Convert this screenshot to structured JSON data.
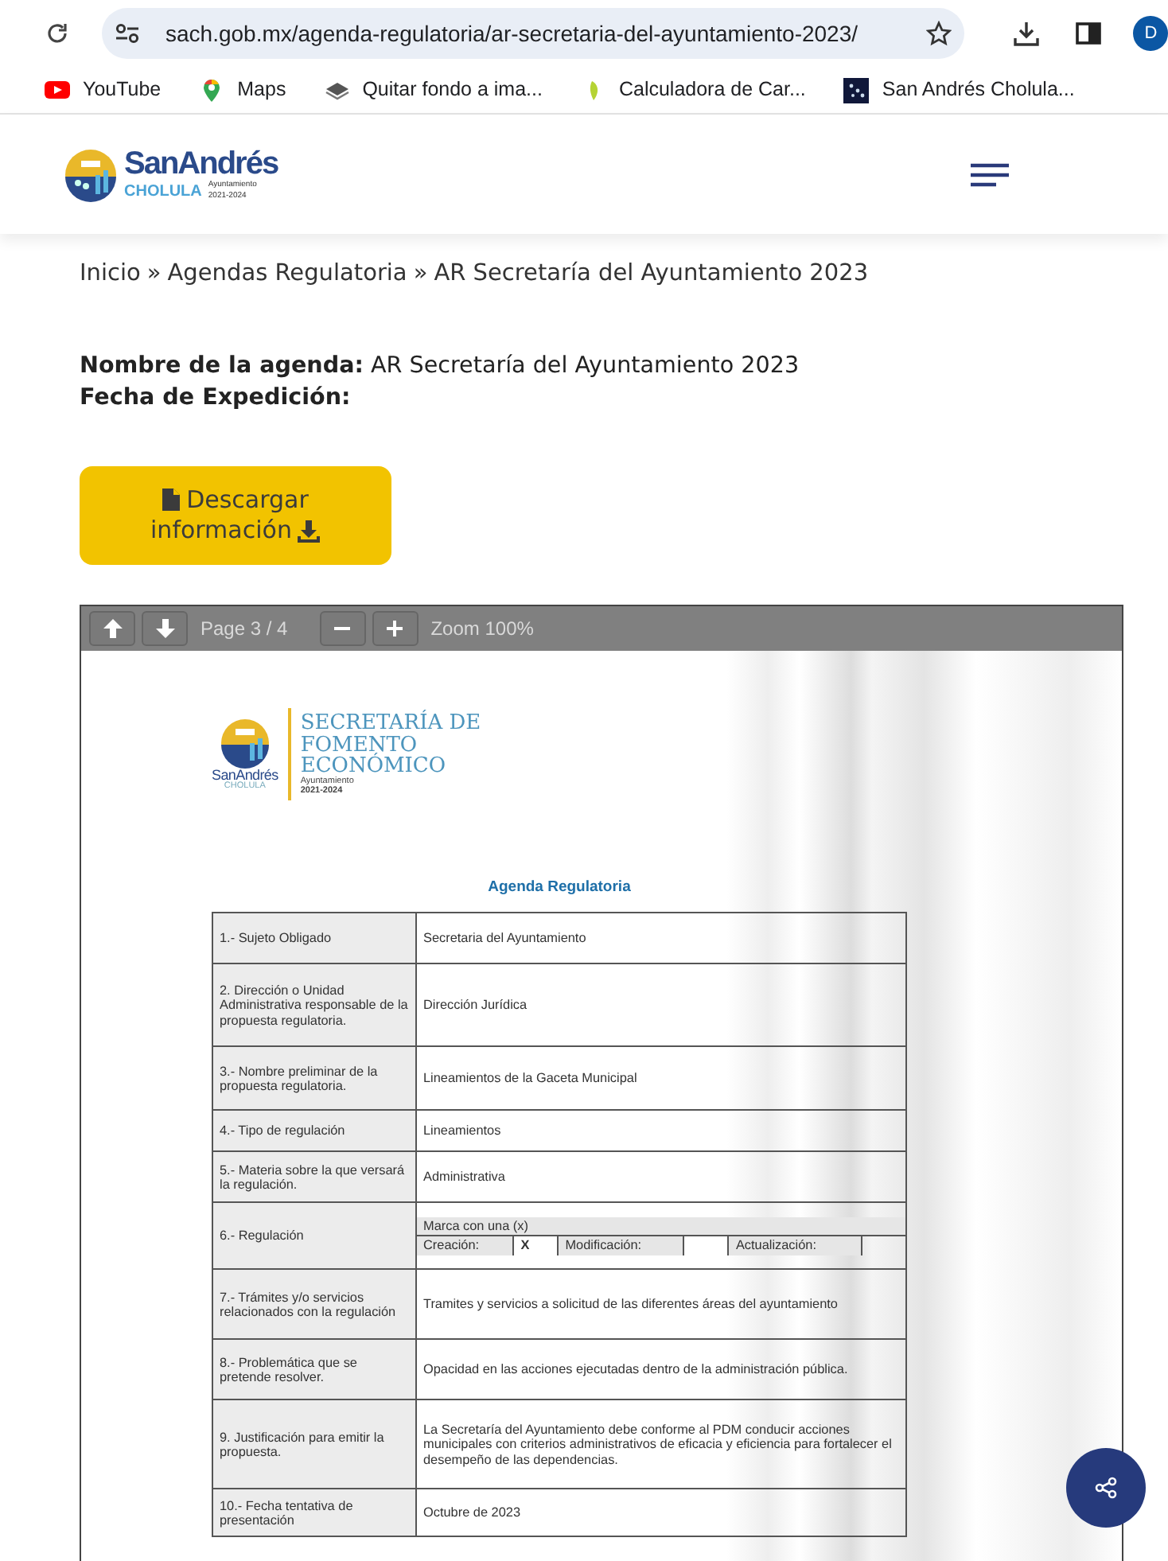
{
  "browser": {
    "url": "sach.gob.mx/agenda-regulatoria/ar-secretaria-del-ayuntamiento-2023/",
    "profile_initial": "D",
    "bookmarks": [
      {
        "label": "YouTube",
        "kind": "youtube"
      },
      {
        "label": "Maps",
        "kind": "maps"
      },
      {
        "label": "Quitar fondo a ima...",
        "kind": "layers"
      },
      {
        "label": "Calculadora de Car...",
        "kind": "leaf"
      },
      {
        "label": "San Andrés Cholula...",
        "kind": "site"
      }
    ]
  },
  "site_logo": {
    "name_a": "San",
    "name_b": "Andrés",
    "place": "CHOLULA",
    "tag_1": "Ayuntamiento",
    "tag_2": "2021-2024"
  },
  "breadcrumb": {
    "separator": "»",
    "items": [
      "Inicio",
      "Agendas Regulatoria",
      "AR Secretaría del Ayuntamiento 2023"
    ]
  },
  "fields": [
    {
      "label": "Nombre de la agenda:",
      "value": "AR Secretaría del Ayuntamiento 2023"
    },
    {
      "label": "Fecha de Expedición:"
    }
  ],
  "download_button": {
    "line_1": "Descargar",
    "line_2": "información"
  },
  "pdf_viewer": {
    "page": "Page 3 / 4",
    "zoom": "Zoom 100%",
    "document": {
      "logo_name_a": "San",
      "logo_name_b": "Andrés",
      "logo_place": "CHOLULA",
      "heading": [
        "SECRETARÍA DE",
        "FOMENTO",
        "ECONÓMICO"
      ],
      "tag_1": "Ayuntamiento",
      "tag_2": "2021-2024",
      "title": "Agenda Regulatoria",
      "rows": [
        {
          "kind": "text",
          "label": "1.- Sujeto Obligado",
          "value": "Secretaria del Ayuntamiento"
        },
        {
          "kind": "text",
          "label": "2.  Dirección o Unidad Administrativa responsable de la propuesta regulatoria.",
          "value": "Dirección Jurídica"
        },
        {
          "kind": "text",
          "label": "3.- Nombre preliminar de la propuesta regulatoria.",
          "value": "Lineamientos de la Gaceta Municipal"
        },
        {
          "kind": "text",
          "label": "4.- Tipo de regulación",
          "value": "Lineamientos"
        },
        {
          "kind": "text",
          "label": "5.- Materia sobre la que versará la regulación.",
          "value": "Administrativa"
        },
        {
          "kind": "options",
          "label": "6.- Regulación",
          "instruction": "Marca con una (x)",
          "options": [
            {
              "label": "Creación:",
              "mark": "X"
            },
            {
              "label": "Modificación:"
            },
            {
              "label": "Actualización:"
            }
          ]
        },
        {
          "kind": "text",
          "label": "7.- Trámites y/o servicios relacionados con la regulación",
          "value": "Tramites y servicios a solicitud de las diferentes áreas del ayuntamiento"
        },
        {
          "kind": "text",
          "label": "8.- Problemática que se pretende resolver.",
          "value": "Opacidad en las acciones ejecutadas dentro de la administración pública."
        },
        {
          "kind": "text",
          "label": "9.  Justificación para emitir la propuesta.",
          "value": "La Secretaría del Ayuntamiento debe conforme al PDM conducir acciones municipales con criterios administrativos de eficacia y eficiencia para fortalecer el desempeño de las dependencias."
        },
        {
          "kind": "text",
          "label": "10.- Fecha tentativa de presentación",
          "value": "Octubre de 2023"
        }
      ]
    }
  }
}
